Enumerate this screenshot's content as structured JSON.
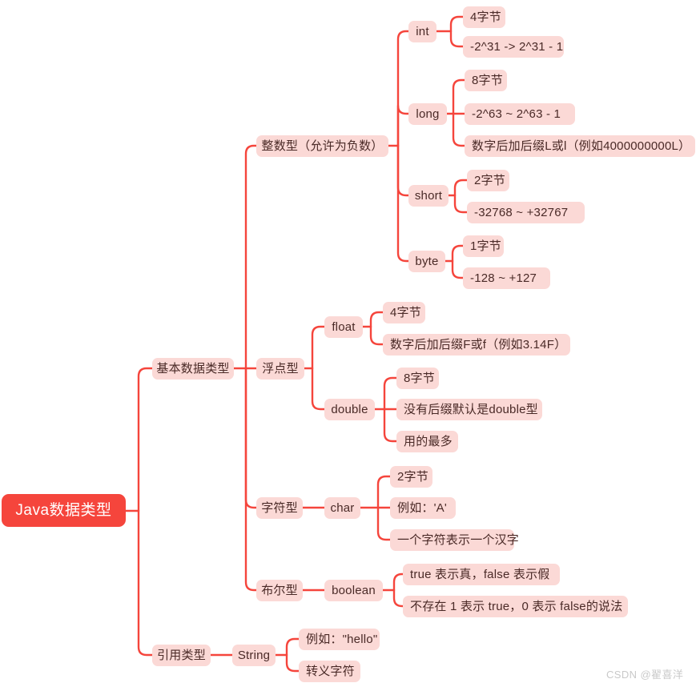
{
  "diagram": {
    "title": "Java数据类型",
    "type": "mind-map",
    "accent_color": "#f5453c",
    "node_fill": "#fbd9d6",
    "node_text_color": "#4a2a27",
    "root_text_color": "#ffffff",
    "background": "#ffffff"
  },
  "root": {
    "label": "Java数据类型"
  },
  "branches": {
    "primitive": {
      "label": "基本数据类型"
    },
    "reference": {
      "label": "引用类型"
    }
  },
  "groups": {
    "integer": {
      "label": "整数型（允许为负数）"
    },
    "float_group": {
      "label": "浮点型"
    },
    "char_group": {
      "label": "字符型"
    },
    "bool_group": {
      "label": "布尔型"
    }
  },
  "types": {
    "int": {
      "label": "int",
      "details": [
        "4字节",
        "-2^31 -> 2^31 - 1"
      ]
    },
    "long": {
      "label": "long",
      "details": [
        "8字节",
        "-2^63 ~ 2^63 - 1",
        "数字后加后缀L或l（例如4000000000L）"
      ]
    },
    "short": {
      "label": "short",
      "details": [
        "2字节",
        "-32768 ~ +32767"
      ]
    },
    "byte": {
      "label": "byte",
      "details": [
        "1字节",
        "-128 ~ +127"
      ]
    },
    "float": {
      "label": "float",
      "details": [
        "4字节",
        "数字后加后缀F或f（例如3.14F）"
      ]
    },
    "double": {
      "label": "double",
      "details": [
        "8字节",
        "没有后缀默认是double型",
        "用的最多"
      ]
    },
    "char": {
      "label": "char",
      "details": [
        "2字节",
        "例如：'A'",
        "一个字符表示一个汉字"
      ]
    },
    "boolean": {
      "label": "boolean",
      "details": [
        "true 表示真，false 表示假",
        "不存在 1 表示 true，0 表示 false的说法"
      ]
    },
    "string": {
      "label": "String",
      "details": [
        "例如：\"hello\"",
        "转义字符"
      ]
    }
  },
  "watermark": {
    "text": "CSDN @翟喜洋"
  }
}
